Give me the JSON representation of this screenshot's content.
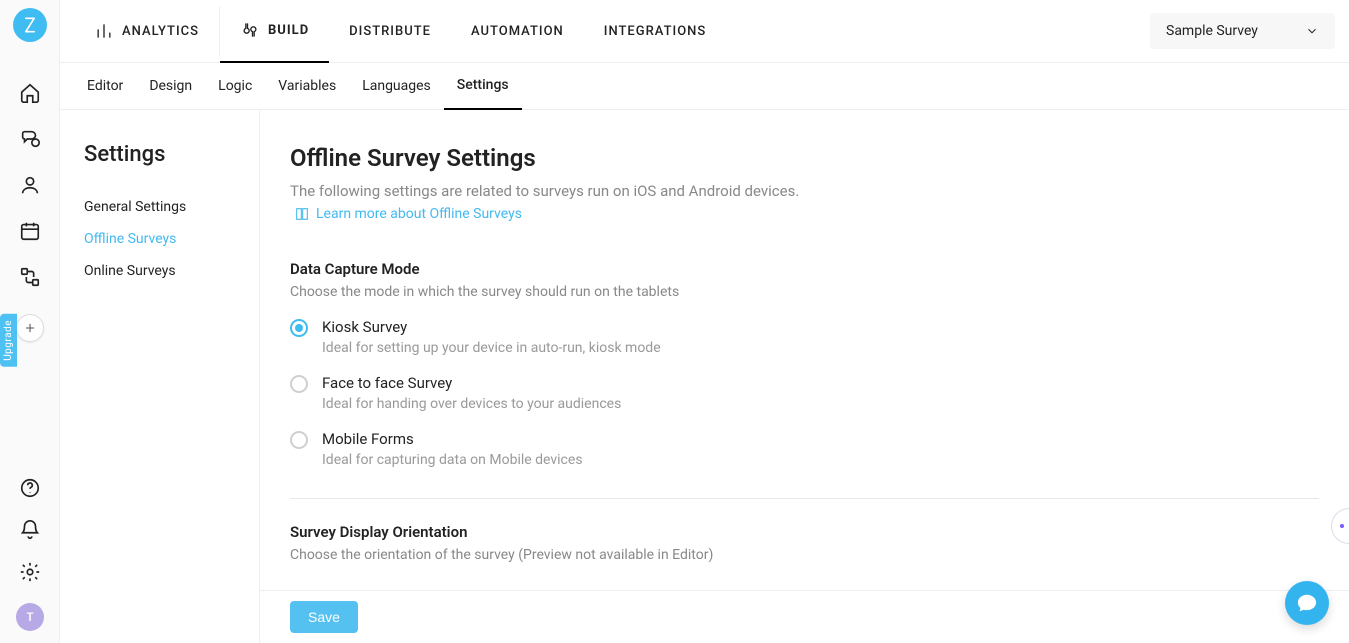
{
  "left_rail": {
    "avatar_letter": "T",
    "upgrade_label": "Upgrade"
  },
  "topnav": {
    "items": [
      {
        "label": "ANALYTICS"
      },
      {
        "label": "BUILD"
      },
      {
        "label": "DISTRIBUTE"
      },
      {
        "label": "AUTOMATION"
      },
      {
        "label": "INTEGRATIONS"
      }
    ],
    "active_index": 1
  },
  "survey_dropdown": {
    "selected": "Sample Survey"
  },
  "subtabs": {
    "items": [
      "Editor",
      "Design",
      "Logic",
      "Variables",
      "Languages",
      "Settings"
    ],
    "active_index": 5
  },
  "sidebar": {
    "title": "Settings",
    "items": [
      "General Settings",
      "Offline Surveys",
      "Online Surveys"
    ],
    "active_index": 1
  },
  "page": {
    "title": "Offline Survey Settings",
    "description": "The following settings are related to surveys run on iOS and Android devices.",
    "learn_more": "Learn more about Offline Surveys"
  },
  "data_capture": {
    "title": "Data Capture Mode",
    "description": "Choose the mode in which the survey should run on the tablets",
    "options": [
      {
        "label": "Kiosk Survey",
        "sub": "Ideal for setting up your device in auto-run, kiosk mode"
      },
      {
        "label": "Face to face Survey",
        "sub": "Ideal for handing over devices to your audiences"
      },
      {
        "label": "Mobile Forms",
        "sub": "Ideal for capturing data on Mobile devices"
      }
    ],
    "selected_index": 0
  },
  "orientation": {
    "title": "Survey Display Orientation",
    "description": "Choose the orientation of the survey (Preview not available in Editor)"
  },
  "buttons": {
    "save": "Save"
  }
}
